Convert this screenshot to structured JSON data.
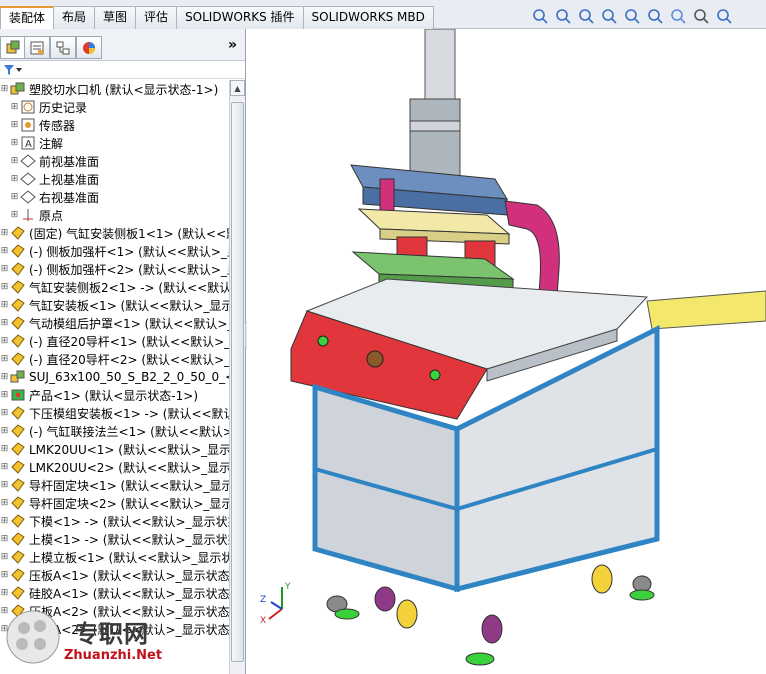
{
  "tabs": [
    "装配体",
    "布局",
    "草图",
    "评估",
    "SOLIDWORKS 插件",
    "SOLIDWORKS MBD"
  ],
  "panel_tabs": [
    "featuremanager-icon",
    "propertymanager-icon",
    "configurationmanager-icon",
    "appearance-icon"
  ],
  "panel_more": "»",
  "filter_icon": "funnel-icon",
  "tree": {
    "root": "塑胶切水口机  (默认<显示状态-1>)",
    "items": [
      {
        "label": "历史记录",
        "icon": "history-icon"
      },
      {
        "label": "传感器",
        "icon": "sensor-icon"
      },
      {
        "label": "注解",
        "icon": "annotation-icon"
      },
      {
        "label": "前视基准面",
        "icon": "plane-icon"
      },
      {
        "label": "上视基准面",
        "icon": "plane-icon"
      },
      {
        "label": "右视基准面",
        "icon": "plane-icon"
      },
      {
        "label": "原点",
        "icon": "origin-icon"
      },
      {
        "label": "(固定) 气缸安装侧板1<1> (默认<<默",
        "icon": "part-icon"
      },
      {
        "label": "(-) 侧板加强杆<1> (默认<<默认>_显",
        "icon": "part-icon"
      },
      {
        "label": "(-) 侧板加强杆<2> (默认<<默认>_显",
        "icon": "part-icon"
      },
      {
        "label": "气缸安装侧板2<1> -> (默认<<默认>",
        "icon": "part-icon"
      },
      {
        "label": "气缸安装板<1> (默认<<默认>_显示",
        "icon": "part-icon"
      },
      {
        "label": "气动模组后护罩<1> (默认<<默认>_",
        "icon": "part-icon"
      },
      {
        "label": "(-) 直径20导杆<1> (默认<<默认>_显",
        "icon": "part-icon"
      },
      {
        "label": "(-) 直径20导杆<2> (默认<<默认>_显",
        "icon": "part-icon"
      },
      {
        "label": "SUJ_63x100_50_S_B2_2_0_50_0_<1",
        "icon": "assembly-icon"
      },
      {
        "label": "产品<1> (默认<显示状态-1>)",
        "icon": "colored-part-icon"
      },
      {
        "label": "下压模组安装板<1> -> (默认<<默认",
        "icon": "part-icon"
      },
      {
        "label": "(-) 气缸联接法兰<1> (默认<<默认>",
        "icon": "part-icon"
      },
      {
        "label": "LMK20UU<1> (默认<<默认>_显示",
        "icon": "part-icon"
      },
      {
        "label": "LMK20UU<2> (默认<<默认>_显示",
        "icon": "part-icon"
      },
      {
        "label": "导杆固定块<1> (默认<<默认>_显示",
        "icon": "part-icon"
      },
      {
        "label": "导杆固定块<2> (默认<<默认>_显示",
        "icon": "part-icon"
      },
      {
        "label": "下模<1> -> (默认<<默认>_显示状态",
        "icon": "part-icon"
      },
      {
        "label": "上模<1> -> (默认<<默认>_显示状态",
        "icon": "part-icon"
      },
      {
        "label": "上模立板<1> (默认<<默认>_显示状",
        "icon": "part-icon"
      },
      {
        "label": "压板A<1> (默认<<默认>_显示状态-",
        "icon": "part-icon"
      },
      {
        "label": "硅胶A<1> (默认<<默认>_显示状态-",
        "icon": "part-icon"
      },
      {
        "label": "压板A<2> (默认<<默认>_显示状态",
        "icon": "part-icon"
      },
      {
        "label": "硅胶A<2> (默认<<默认>_显示状态",
        "icon": "part-icon"
      }
    ]
  },
  "view_toolbar": [
    "zoom-to-fit-icon",
    "zoom-area-icon",
    "previous-view-icon",
    "section-view-icon",
    "dynamic-annotation-icon",
    "view-orientation-icon",
    "display-style-icon",
    "hide-show-icon",
    "appearance-icon"
  ],
  "triad": {
    "x": "X",
    "y": "Y",
    "z": "Z"
  },
  "watermark": {
    "cn": "专职网",
    "en": "Zhuanzhi.Net"
  },
  "colors": {
    "tab_accent": "#e59a2d",
    "machine_frame": "#2f84c4",
    "machine_red": "#e1363b",
    "plate_green": "#7bc36e",
    "plate_yellow": "#f2e36a",
    "magenta": "#d1307d"
  }
}
